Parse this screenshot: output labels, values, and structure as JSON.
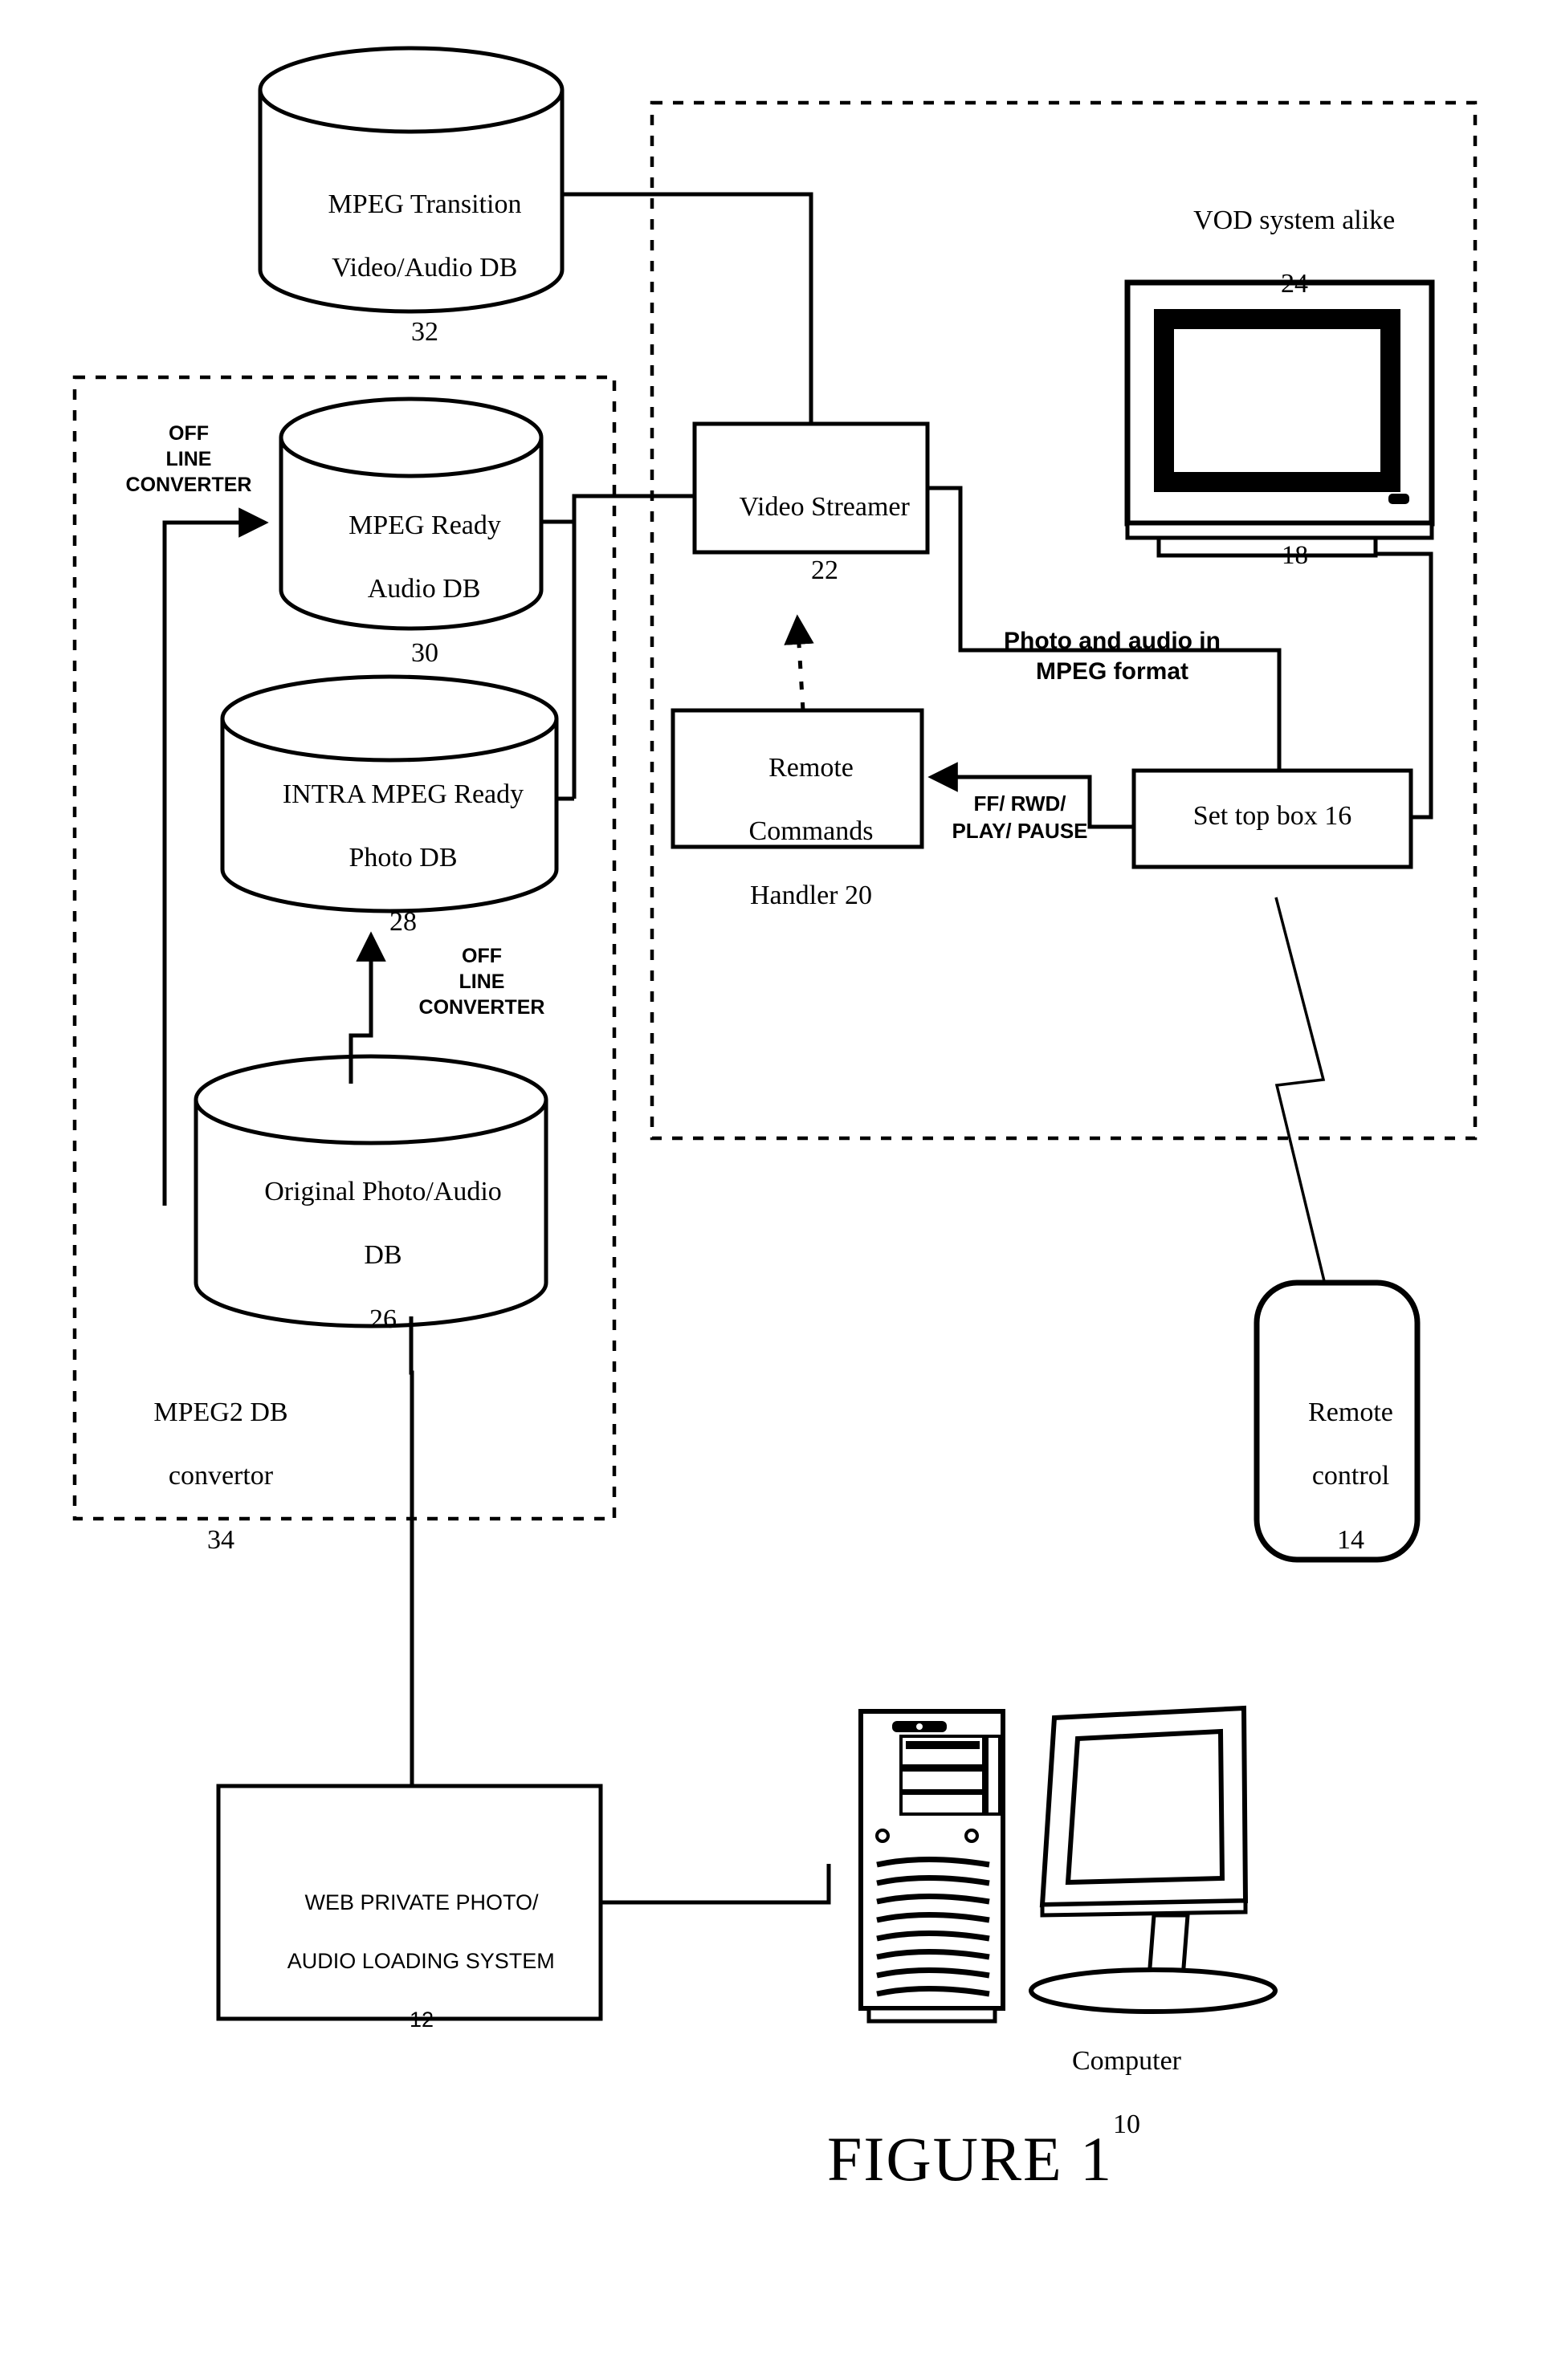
{
  "figure": {
    "caption": "FIGURE 1",
    "title": "System block diagram"
  },
  "databases": [
    {
      "id": "db-32",
      "line1": "MPEG Transition",
      "line2": "Video/Audio DB",
      "ref": "32"
    },
    {
      "id": "db-30",
      "line1": "MPEG Ready",
      "line2": "Audio DB",
      "ref": "30"
    },
    {
      "id": "db-28",
      "line1": "INTRA MPEG Ready",
      "line2": "Photo DB",
      "ref": "28"
    },
    {
      "id": "db-26",
      "line1": "Original Photo/Audio",
      "line2": "DB",
      "ref": "26"
    }
  ],
  "boxes": [
    {
      "id": "video-streamer",
      "line1": "Video Streamer",
      "ref": "22"
    },
    {
      "id": "remote-commands-handler",
      "line1": "Remote",
      "line2": "Commands",
      "line3": "Handler 20"
    },
    {
      "id": "set-top-box",
      "line1": "Set top box 16"
    },
    {
      "id": "web-loading-system",
      "line1": "WEB PRIVATE PHOTO/",
      "line2": "AUDIO LOADING SYSTEM",
      "ref": "12"
    }
  ],
  "groups": {
    "mpeg2_converter": {
      "line1": "MPEG2 DB",
      "line2": "convertor",
      "ref": "34"
    },
    "vod_system": {
      "line1": "VOD system alike",
      "ref": "24"
    }
  },
  "edge_labels": {
    "offline_converter_top": "OFF\nLINE\nCONVERTER",
    "offline_converter_mid": "OFF\nLINE\nCONVERTER",
    "photo_audio_mpeg": "Photo and audio in\nMPEG format",
    "transport_commands": "FF/ RWD/\nPLAY/ PAUSE"
  },
  "devices": {
    "television": {
      "ref": "18"
    },
    "remote_control": {
      "line1": "Remote",
      "line2": "control",
      "ref": "14"
    },
    "computer": {
      "label": "Computer",
      "ref": "10"
    }
  },
  "colors": {
    "stroke": "#000000",
    "background": "#ffffff"
  }
}
